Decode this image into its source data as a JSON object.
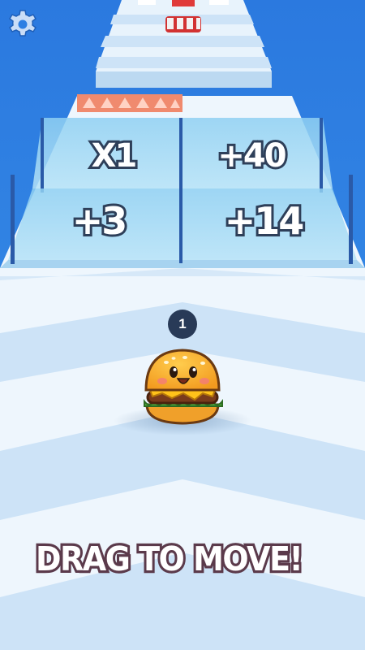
{
  "hud": {
    "settings_icon": "gear-icon",
    "count": "1"
  },
  "gates": {
    "far_row": {
      "left": "",
      "right": ""
    },
    "row1": {
      "left": "X1",
      "right": "+40"
    },
    "row2": {
      "left": "+3",
      "right": "+14"
    }
  },
  "obstacles": {
    "spike_strip": "spikes",
    "far_cans": "cans"
  },
  "player": {
    "character": "burger"
  },
  "hint": {
    "text": "DRAG TO MOVE!"
  },
  "colors": {
    "sky": "#2e7fe3",
    "track_light": "#eef6fd",
    "track_stripe": "#cde3f7",
    "gate_glass": "#7cc4ef",
    "badge": "#283a57",
    "hint_outline": "#5b3a4b"
  }
}
